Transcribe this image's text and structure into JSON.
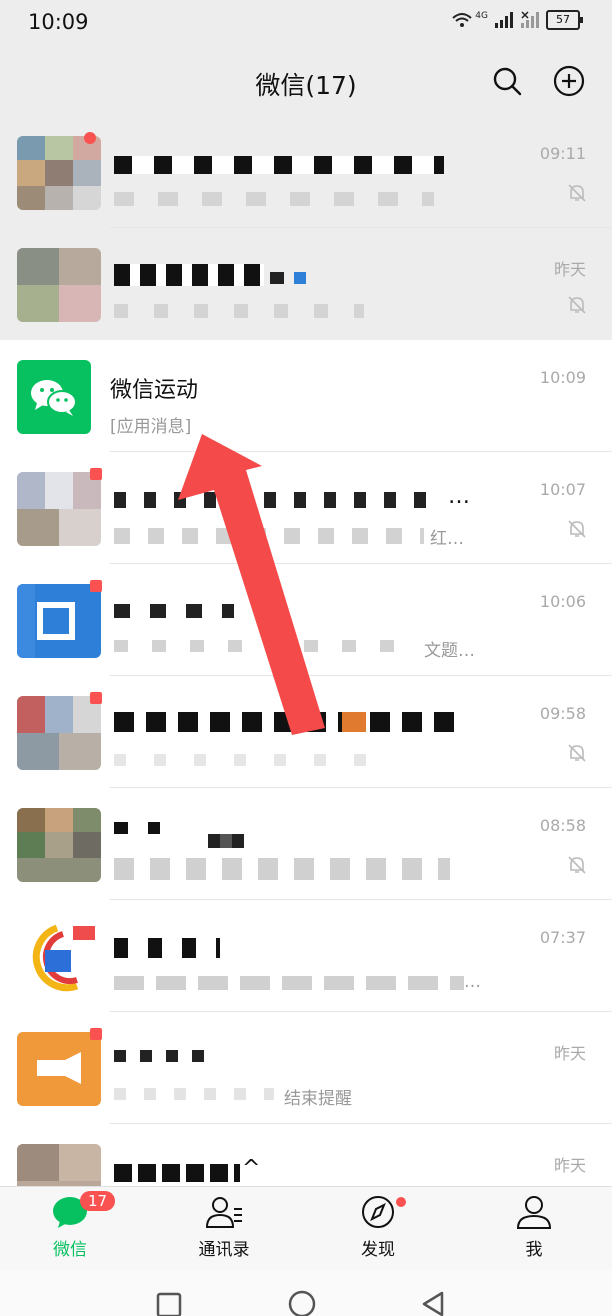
{
  "status_bar": {
    "time": "10:09",
    "network": "4G",
    "battery": "57"
  },
  "header": {
    "title": "微信(17)"
  },
  "chats": [
    {
      "name": "",
      "preview": "",
      "time": "09:11",
      "muted": true
    },
    {
      "name": "",
      "preview": "",
      "time": "昨天",
      "muted": true
    },
    {
      "name": "微信运动",
      "preview": "[应用消息]",
      "time": "10:09",
      "muted": false
    },
    {
      "name": "…",
      "preview": "红…",
      "time": "10:07",
      "muted": true
    },
    {
      "name": "",
      "preview": "文题…",
      "time": "10:06",
      "muted": false
    },
    {
      "name": "",
      "preview": "",
      "time": "09:58",
      "muted": true
    },
    {
      "name": "",
      "preview": "",
      "time": "08:58",
      "muted": true
    },
    {
      "name": "",
      "preview": "…",
      "time": "07:37",
      "muted": false
    },
    {
      "name": "",
      "preview": "结束提醒",
      "time": "昨天",
      "muted": false
    },
    {
      "name": "^",
      "preview": "",
      "time": "昨天",
      "muted": false
    }
  ],
  "tabs": [
    {
      "label": "微信",
      "badge": "17"
    },
    {
      "label": "通讯录"
    },
    {
      "label": "发现"
    },
    {
      "label": "我"
    }
  ],
  "colors": {
    "accent": "#07c160",
    "alert": "#fa5151",
    "arrow": "#f44a4a"
  }
}
